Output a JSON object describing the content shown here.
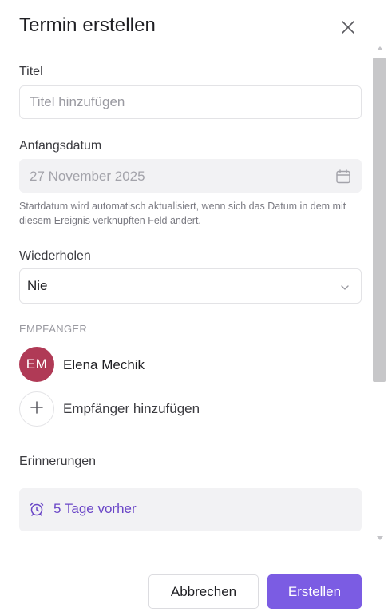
{
  "dialog": {
    "title": "Termin erstellen"
  },
  "fields": {
    "title_label": "Titel",
    "title_placeholder": "Titel hinzufügen",
    "title_value": "",
    "start_label": "Anfangsdatum",
    "start_value": "27 November 2025",
    "start_hint": "Startdatum wird automatisch aktualisiert, wenn sich das Datum in dem mit diesem Ereignis verknüpften Feld ändert.",
    "repeat_label": "Wiederholen",
    "repeat_value": "Nie"
  },
  "recipients": {
    "section_label": "EMPFÄNGER",
    "items": [
      {
        "initials": "EM",
        "name": "Elena Mechik",
        "color": "#b03a56"
      }
    ],
    "add_label": "Empfänger hinzufügen"
  },
  "reminders": {
    "label": "Erinnerungen",
    "items": [
      {
        "text": "5 Tage vorher",
        "icon": "alarm-clock-icon",
        "color": "#6a46c7"
      }
    ]
  },
  "footer": {
    "cancel_label": "Abbrechen",
    "create_label": "Erstellen",
    "accent": "#7b5ce3"
  }
}
